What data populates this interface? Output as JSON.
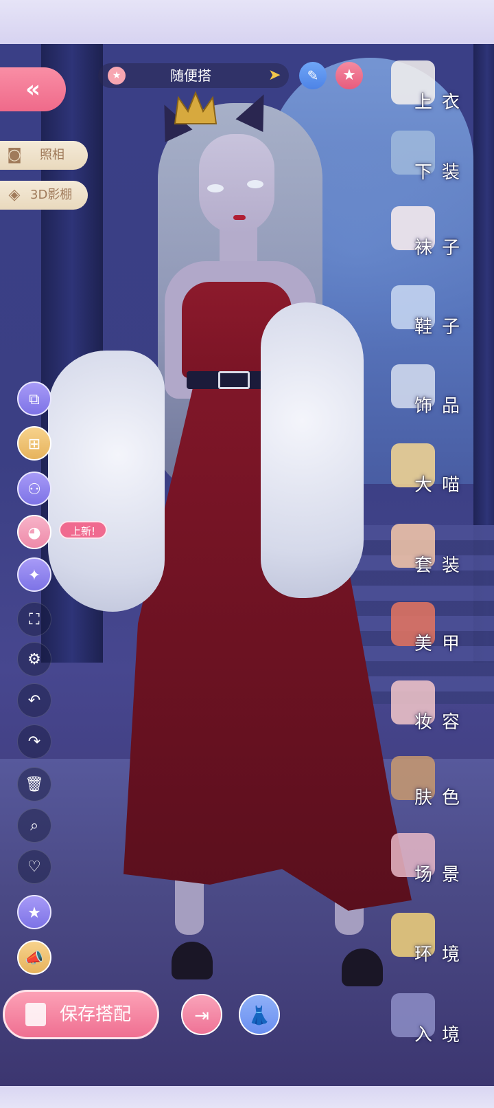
{
  "header": {
    "outfit_name": "随便搭",
    "star_icon": "star-icon",
    "next_icon": "arrow-right-icon",
    "edit_icon": "pencil-icon",
    "favorite_icon": "star-icon"
  },
  "left_panel": {
    "back_icon": "double-chevron-left-icon",
    "photo_label": "照相",
    "studio_label": "3D影棚",
    "new_badge": "上新!"
  },
  "categories": [
    {
      "label": "上衣",
      "icon": "shirt-icon",
      "color": "#f6f2ee"
    },
    {
      "label": "下装",
      "icon": "shorts-icon",
      "color": "#9fb9dc"
    },
    {
      "label": "袜子",
      "icon": "sock-icon",
      "color": "#fbeeee"
    },
    {
      "label": "鞋子",
      "icon": "heel-shoe-icon",
      "color": "#c9d8f2"
    },
    {
      "label": "饰品",
      "icon": "tiara-icon",
      "color": "#d6def0"
    },
    {
      "label": "大喵",
      "icon": "cat-icon",
      "color": "#f7d892"
    },
    {
      "label": "套装",
      "icon": "outfit-set-icon",
      "color": "#f6c8a8"
    },
    {
      "label": "美甲",
      "icon": "nail-polish-icon",
      "color": "#e6765f"
    },
    {
      "label": "妆容",
      "icon": "makeup-icon",
      "color": "#f3c7c9"
    },
    {
      "label": "肤色",
      "icon": "skin-palette-icon",
      "color": "#c99a6e"
    },
    {
      "label": "场景",
      "icon": "scene-frame-icon",
      "color": "#e7b9c7"
    },
    {
      "label": "环境",
      "icon": "moon-environment-icon",
      "color": "#f2d27a"
    },
    {
      "label": "入境",
      "icon": "window-moon-icon",
      "color": "#8d8ec7"
    }
  ],
  "bottom": {
    "save_label": "保存搭配"
  },
  "colors": {
    "accent_pink": "#ef6a8a",
    "gold": "#f2c64a",
    "blue": "#4d83e6"
  }
}
